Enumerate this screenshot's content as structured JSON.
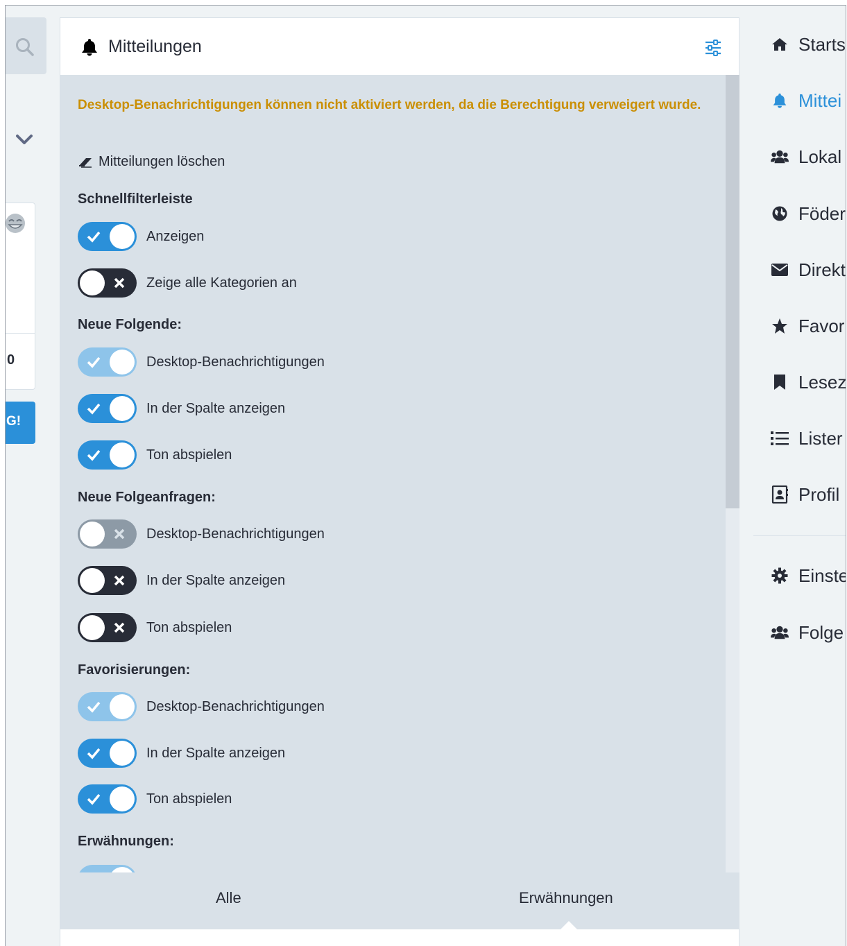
{
  "left": {
    "char_count": "0",
    "publish_label": "G!"
  },
  "column": {
    "title": "Mitteilungen",
    "warning": "Desktop-Benachrichtigungen können nicht aktiviert werden, da die Berechtigung verweigert wurde.",
    "clear_label": "Mitteilungen löschen",
    "sections": [
      {
        "title": "Schnellfilterleiste",
        "toggles": [
          {
            "label": "Anzeigen",
            "state": "on"
          },
          {
            "label": "Zeige alle Kategorien an",
            "state": "off"
          }
        ]
      },
      {
        "title": "Neue Folgende:",
        "toggles": [
          {
            "label": "Desktop-Benachrichtigungen",
            "state": "disabled-on"
          },
          {
            "label": "In der Spalte anzeigen",
            "state": "on"
          },
          {
            "label": "Ton abspielen",
            "state": "on"
          }
        ]
      },
      {
        "title": "Neue Folgeanfragen:",
        "toggles": [
          {
            "label": "Desktop-Benachrichtigungen",
            "state": "disabled-off"
          },
          {
            "label": "In der Spalte anzeigen",
            "state": "off"
          },
          {
            "label": "Ton abspielen",
            "state": "off"
          }
        ]
      },
      {
        "title": "Favorisierungen:",
        "toggles": [
          {
            "label": "Desktop-Benachrichtigungen",
            "state": "disabled-on"
          },
          {
            "label": "In der Spalte anzeigen",
            "state": "on"
          },
          {
            "label": "Ton abspielen",
            "state": "on"
          }
        ]
      },
      {
        "title": "Erwähnungen:",
        "toggles": [
          {
            "label": "",
            "state": "disabled-on"
          }
        ]
      }
    ],
    "tabs": [
      {
        "label": "Alle",
        "active": false
      },
      {
        "label": "Erwähnungen",
        "active": true
      }
    ]
  },
  "nav": {
    "items": [
      {
        "label": "Starts",
        "icon": "home-icon",
        "active": false
      },
      {
        "label": "Mittei",
        "icon": "bell-icon",
        "active": true
      },
      {
        "label": "Lokal",
        "icon": "users-icon",
        "active": false
      },
      {
        "label": "Föder",
        "icon": "globe-icon",
        "active": false
      },
      {
        "label": "Direkt",
        "icon": "envelope-icon",
        "active": false
      },
      {
        "label": "Favor",
        "icon": "star-icon",
        "active": false
      },
      {
        "label": "Lesez",
        "icon": "bookmark-icon",
        "active": false
      },
      {
        "label": "Lister",
        "icon": "list-icon",
        "active": false
      },
      {
        "label": "Profil",
        "icon": "address-book-icon",
        "active": false
      },
      {
        "label": "Einste",
        "icon": "gear-icon",
        "active": false
      },
      {
        "label": "Folge",
        "icon": "users-icon",
        "active": false
      }
    ]
  },
  "colors": {
    "accent": "#2b90d9",
    "warning": "#ca8f04",
    "text": "#282c37",
    "panel": "#d9e1e8",
    "background": "#eff3f5"
  }
}
